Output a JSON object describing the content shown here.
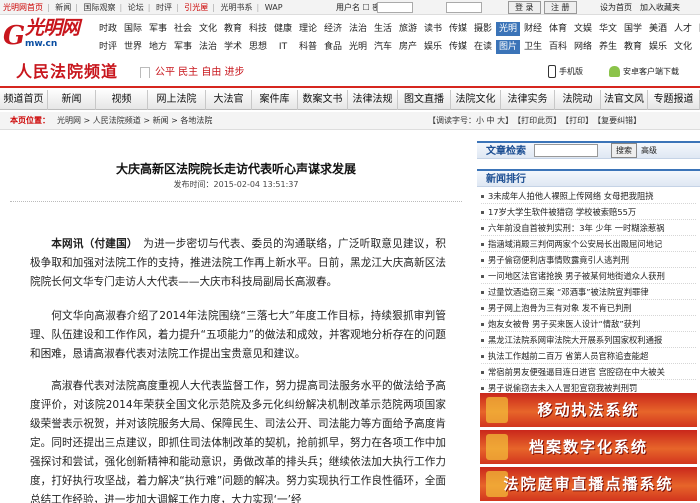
{
  "topbar": {
    "links": [
      "光明网首页",
      "新闻",
      "国际观察",
      "论坛",
      "时评",
      "引光屋",
      "光明书系",
      "WAP"
    ],
    "acct_label": "用户名 ☐  密码 ☐",
    "login_label": "登 录",
    "register_label": "注 册",
    "right_label": "设为首页　加入收藏夹"
  },
  "logo": {
    "mark": "G",
    "chinese": "光明网",
    "domain": "mw.cn"
  },
  "channels": {
    "row1": [
      "时政",
      "国际",
      "军事",
      "社会",
      "文化",
      "教育",
      "科技",
      "健康",
      "理论",
      "经济",
      "法治",
      "生活",
      "旅游",
      "读书",
      "传媒",
      "摄影",
      "光明",
      "财经",
      "体育",
      "文娱",
      "华文",
      "国学",
      "美酒",
      "人才",
      "图书"
    ],
    "row2": [
      "时评",
      "世界",
      "地方",
      "军事",
      "法治",
      "学术",
      "思想",
      "IT",
      "科普",
      "食品",
      "光明",
      "汽车",
      "房产",
      "娱乐",
      "传媒",
      "在读",
      "图片",
      "卫生",
      "百科",
      "网络",
      "养生",
      "教育",
      "娱乐",
      "文化"
    ]
  },
  "banner": {
    "title": "人民法院频道",
    "slogan": "公平 民主 自由 进步",
    "mobile_label": "手机版",
    "android_label": "安卓客户端下载"
  },
  "nav": [
    "频道首页",
    "新闻",
    "视频",
    "网上法院",
    "大法官",
    "案件库",
    "数案文书",
    "法律法规",
    "图文直播",
    "法院文化",
    "法律实务",
    "法院动",
    "法官文风",
    "专题报道"
  ],
  "breadcrumb": {
    "here_label": "本页位置：",
    "path": "光明网 > 人民法院频道 > 新闻 > 各地法院",
    "tools": "【调读字号：小 中 大】　【打印此页】　【打印】　【复要纠错】"
  },
  "article": {
    "title": "大庆高新区法院院长走访代表听心声谋求发展",
    "date": "发布时间：2015-02-04 13:51:37",
    "lead_source": "本网讯（付建国）",
    "paragraphs": [
      "为进一步密切与代表、委员的沟通联络，广泛听取意见建议，积极争取和加强对法院工作的支持，推进法院工作再上新水平。日前，黑龙江大庆高新区法院院长何文华专门走访人大代表——大庆市科技局副局长高淑春。",
      "何文华向高淑春介绍了2014年法院围绕“三落七大”年度工作目标，持续狠抓审判管理、队伍建设和工作作风，着力提升“五项能力”的做法和成效，并客观地分析存在的问题和困难，恳请高淑春代表对法院工作提出宝贵意见和建议。",
      "高淑春代表对法院高度重视人大代表监督工作，努力提高司法服务水平的做法给予高度评价，对该院2014年荣获全国文化示范院及多元化纠纷解决机制改革示范院两项国家级荣誉表示祝贺，并对该院服务大局、保障民生、司法公开、司法能力等方面给予高度肯定。同时还提出三点建议，即抓住司法体制改革的契机，抢前抓早，努力在各项工作中加强探讨和尝试，强化创新精神和能动意识，勇做改革的排头兵；继续依法加大执行工作力度，打好执行攻坚战，着力解决“执行难”问题的解决。努力实现执行工作良性循环，全面总结工作经验，进一步加大调解工作力度，大力实现‘一’经"
    ]
  },
  "sidebar": {
    "search_title": "文章检索",
    "search_button": "搜索",
    "advanced_label": "高级",
    "ranking_title": "新闻排行",
    "ranking": [
      "3未成年人拍他人裸照上传网络 女母把我阻挠",
      "17岁大学生软件被猎窃 学校被索赔55万",
      "六年前没自首被判实刑：3年 少年 一时糊涂惹祸",
      "指涵域消殿三判伺两家个公安局长出殿屈问地记",
      "男子偷窃便利店事情败露竟引人逃判刑",
      "一问地区法官诸抢换 男子被某何地街道众人获刑",
      "过量饮酒造窃三案 “邓酒事”被法院宣判罪律",
      "男子网上泡骨为三有对象 发不肯已判刑",
      "炮友女被骨 男子买来医人设计“情敌”获判",
      "黑龙江法院系网审法院大开展系列国家权利通报",
      "执法工作越前二百万 省第人员官称追查能超",
      "常宿前男友便强逼目连日进官 宫腔窃在中大被关",
      "男子说偷窃去未入人冒犯宣窃我被判刑罚"
    ],
    "ads": [
      "移动执法系统",
      "档案数字化系统",
      "法院庭审直播点播系统"
    ]
  }
}
